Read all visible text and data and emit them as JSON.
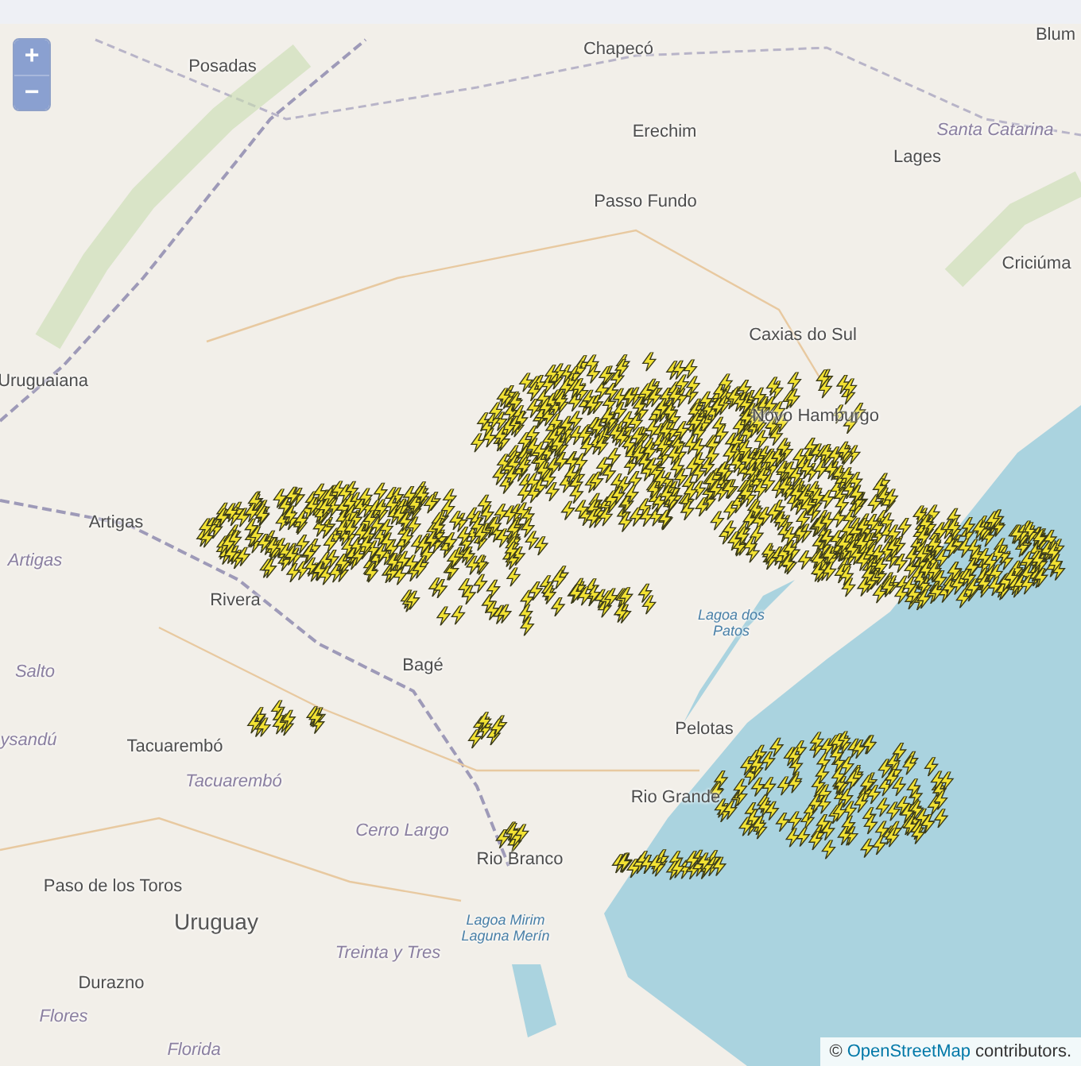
{
  "map": {
    "zoom_controls": [
      "+",
      "−"
    ],
    "places": [
      {
        "name": "Blum",
        "kind": "city"
      },
      {
        "name": "Posadas",
        "kind": "city"
      },
      {
        "name": "Chapecó",
        "kind": "city"
      },
      {
        "name": "Erechim",
        "kind": "city"
      },
      {
        "name": "Santa Catarina",
        "kind": "region"
      },
      {
        "name": "Lages",
        "kind": "city"
      },
      {
        "name": "Passo Fundo",
        "kind": "city"
      },
      {
        "name": "Criciúma",
        "kind": "city"
      },
      {
        "name": "Caxias do Sul",
        "kind": "city"
      },
      {
        "name": "Uruguaiana",
        "kind": "city"
      },
      {
        "name": "Novo Hamburgo",
        "kind": "city"
      },
      {
        "name": "Artigas",
        "kind": "city"
      },
      {
        "name": "Artigas",
        "kind": "region"
      },
      {
        "name": "Rivera",
        "kind": "city"
      },
      {
        "name": "Lagoa dos Patos",
        "kind": "water"
      },
      {
        "name": "Salto",
        "kind": "region"
      },
      {
        "name": "Bagé",
        "kind": "city"
      },
      {
        "name": "Pelotas",
        "kind": "city"
      },
      {
        "name": "ysandú",
        "kind": "region"
      },
      {
        "name": "Tacuarembó",
        "kind": "city"
      },
      {
        "name": "Tacuarembó",
        "kind": "region"
      },
      {
        "name": "Rio Grande",
        "kind": "city"
      },
      {
        "name": "Cerro Largo",
        "kind": "region"
      },
      {
        "name": "Rio Branco",
        "kind": "city"
      },
      {
        "name": "Paso de los Toros",
        "kind": "city"
      },
      {
        "name": "Uruguay",
        "kind": "country"
      },
      {
        "name": "Lagoa Mirim Laguna Merín",
        "kind": "water"
      },
      {
        "name": "Treinta y Tres",
        "kind": "region"
      },
      {
        "name": "Durazno",
        "kind": "city"
      },
      {
        "name": "Flores",
        "kind": "region"
      },
      {
        "name": "Florida",
        "kind": "region"
      }
    ],
    "attribution": {
      "prefix": "©",
      "link": "OpenStreetMap",
      "suffix": "contributors."
    }
  }
}
